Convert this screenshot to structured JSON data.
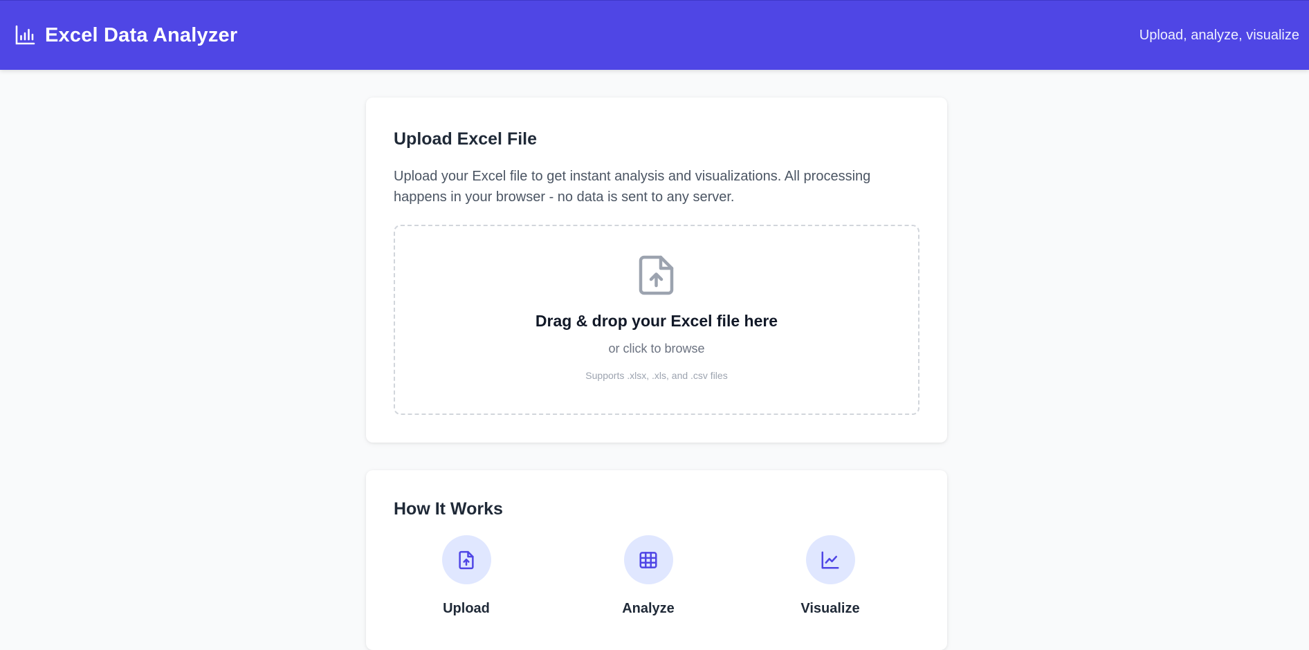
{
  "header": {
    "title": "Excel Data Analyzer",
    "tagline": "Upload, analyze, visualize",
    "logo_icon": "bar-chart-icon"
  },
  "upload_card": {
    "title": "Upload Excel File",
    "description": "Upload your Excel file to get instant analysis and visualizations. All processing happens in your browser - no data is sent to any server.",
    "dropzone": {
      "icon": "file-upload-icon",
      "title": "Drag & drop your Excel file here",
      "subtitle": "or click to browse",
      "hint": "Supports .xlsx, .xls, and .csv files"
    }
  },
  "how_card": {
    "title": "How It Works",
    "steps": [
      {
        "label": "Upload",
        "icon": "file-upload-icon"
      },
      {
        "label": "Analyze",
        "icon": "table-icon"
      },
      {
        "label": "Visualize",
        "icon": "line-chart-icon"
      }
    ]
  },
  "colors": {
    "primary": "#4f46e5",
    "background": "#f9fafb",
    "step_circle": "#e0e7ff"
  }
}
